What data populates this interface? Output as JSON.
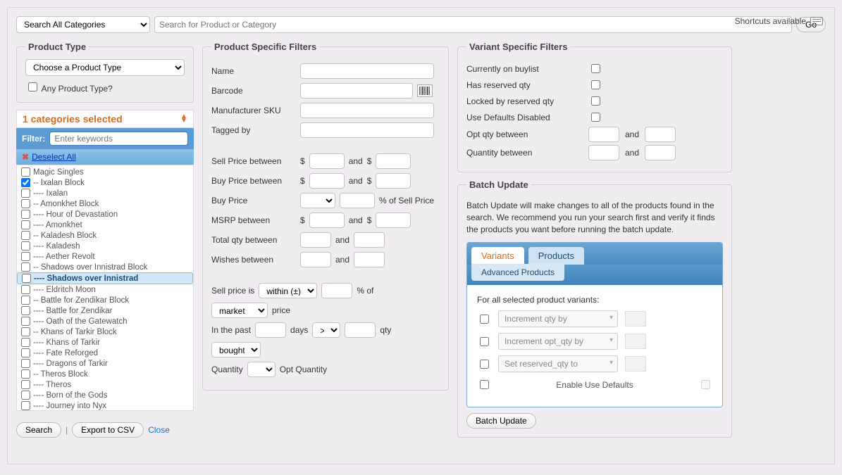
{
  "shortcuts_label": "Shortcuts available",
  "topbar": {
    "category_select": "Search All Categories",
    "search_placeholder": "Search for Product or Category",
    "go": "Go"
  },
  "product_type": {
    "legend": "Product Type",
    "choose": "Choose a Product Type",
    "any": "Any Product Type?"
  },
  "categories": {
    "selected_header": "1 categories selected",
    "filter_label": "Filter:",
    "filter_placeholder": "Enter keywords",
    "deselect_all": "Deselect All",
    "items": [
      {
        "label": "Magic Singles",
        "checked": false,
        "selected": false
      },
      {
        "label": "-- Ixalan Block",
        "checked": true,
        "selected": false
      },
      {
        "label": "---- Ixalan",
        "checked": false,
        "selected": false
      },
      {
        "label": "-- Amonkhet Block",
        "checked": false,
        "selected": false
      },
      {
        "label": "---- Hour of Devastation",
        "checked": false,
        "selected": false
      },
      {
        "label": "---- Amonkhet",
        "checked": false,
        "selected": false
      },
      {
        "label": "-- Kaladesh Block",
        "checked": false,
        "selected": false
      },
      {
        "label": "---- Kaladesh",
        "checked": false,
        "selected": false
      },
      {
        "label": "---- Aether Revolt",
        "checked": false,
        "selected": false
      },
      {
        "label": "-- Shadows over Innistrad Block",
        "checked": false,
        "selected": false
      },
      {
        "label": "---- Shadows over Innistrad",
        "checked": false,
        "selected": true
      },
      {
        "label": "---- Eldritch Moon",
        "checked": false,
        "selected": false
      },
      {
        "label": "-- Battle for Zendikar Block",
        "checked": false,
        "selected": false
      },
      {
        "label": "---- Battle for Zendikar",
        "checked": false,
        "selected": false
      },
      {
        "label": "---- Oath of the Gatewatch",
        "checked": false,
        "selected": false
      },
      {
        "label": "-- Khans of Tarkir Block",
        "checked": false,
        "selected": false
      },
      {
        "label": "---- Khans of Tarkir",
        "checked": false,
        "selected": false
      },
      {
        "label": "---- Fate Reforged",
        "checked": false,
        "selected": false
      },
      {
        "label": "---- Dragons of Tarkir",
        "checked": false,
        "selected": false
      },
      {
        "label": "-- Theros Block",
        "checked": false,
        "selected": false
      },
      {
        "label": "---- Theros",
        "checked": false,
        "selected": false
      },
      {
        "label": "---- Born of the Gods",
        "checked": false,
        "selected": false
      },
      {
        "label": "---- Journey into Nyx",
        "checked": false,
        "selected": false
      }
    ]
  },
  "bottom_actions": {
    "search": "Search",
    "export": "Export to CSV",
    "close": "Close"
  },
  "product_filters": {
    "legend": "Product Specific Filters",
    "name": "Name",
    "barcode": "Barcode",
    "msku": "Manufacturer SKU",
    "tagged": "Tagged by",
    "sell_price_between": "Sell Price between",
    "buy_price_between": "Buy Price between",
    "buy_price": "Buy Price",
    "of_sell_price": "% of Sell Price",
    "msrp_between": "MSRP between",
    "total_qty_between": "Total qty between",
    "wishes_between": "Wishes between",
    "sell_price_is": "Sell price is",
    "within": "within (±)",
    "pct_of": "% of",
    "market": "market",
    "price": "price",
    "in_the_past": "In the past",
    "days": "days",
    "gt": ">",
    "qty": "qty",
    "bought": "bought",
    "quantity": "Quantity",
    "opt_quantity": "Opt Quantity",
    "and": "and",
    "dollar": "$"
  },
  "variant_filters": {
    "legend": "Variant Specific Filters",
    "currently_on_buylist": "Currently on buylist",
    "has_reserved_qty": "Has reserved qty",
    "locked_by_reserved_qty": "Locked by reserved qty",
    "use_defaults_disabled": "Use Defaults Disabled",
    "opt_qty_between": "Opt qty between",
    "quantity_between": "Quantity between",
    "and": "and"
  },
  "batch": {
    "legend": "Batch Update",
    "desc": "Batch Update will make changes to all of the products found in the search. We recommend you run your search first and verify it finds the products you want before running the batch update.",
    "tabs": {
      "variants": "Variants",
      "products": "Products",
      "adv_products": "Advanced Products"
    },
    "section_label": "For all selected product variants:",
    "rows": {
      "inc_qty": "Increment qty by",
      "inc_opt_qty": "Increment opt_qty by",
      "set_reserved": "Set reserved_qty to",
      "enable_defaults": "Enable Use Defaults"
    },
    "btn": "Batch Update"
  }
}
